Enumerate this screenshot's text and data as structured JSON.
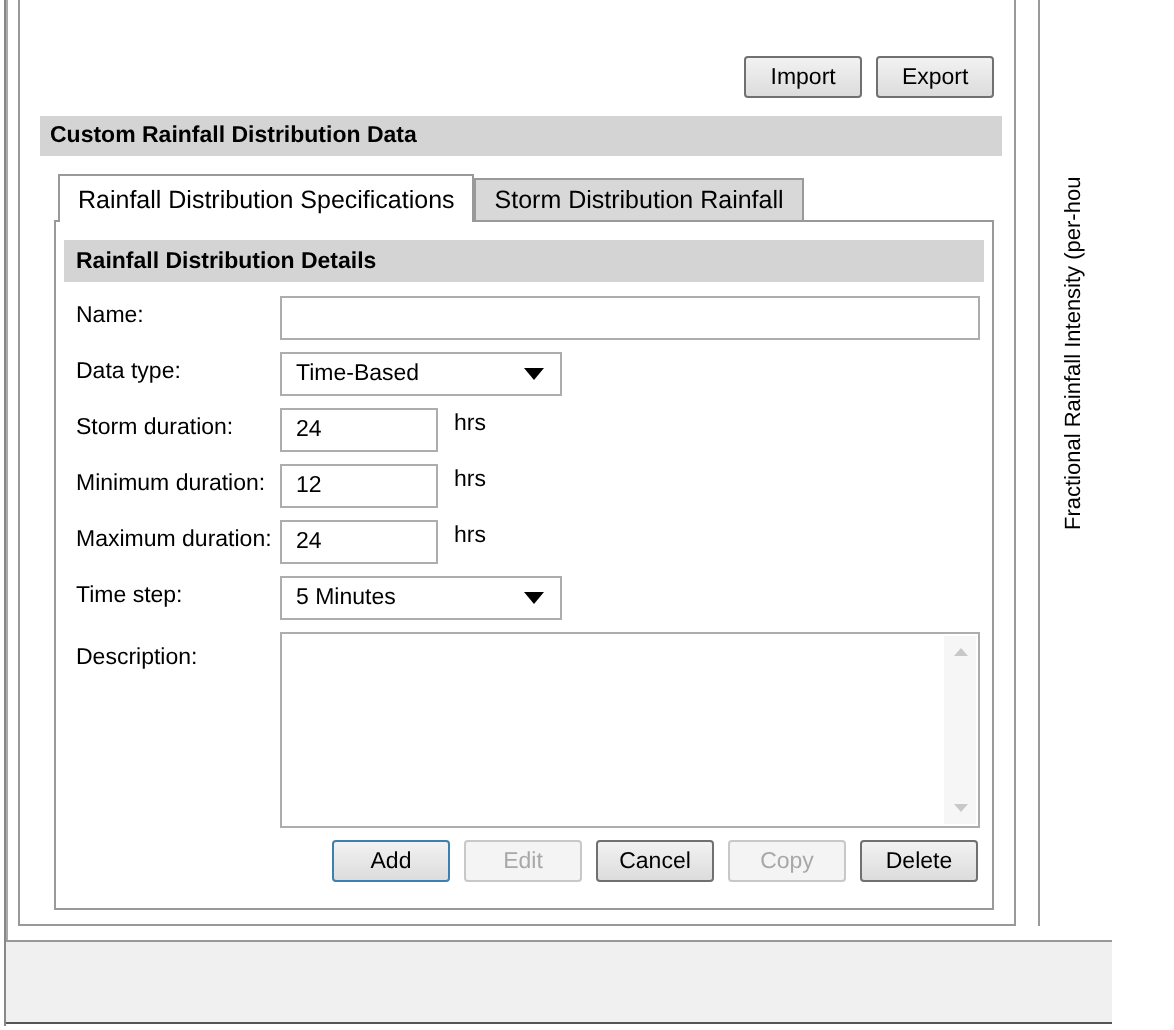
{
  "toolbar": {
    "buttons": [
      {
        "label": "Import",
        "disabled": false
      },
      {
        "label": "Export",
        "disabled": false
      }
    ]
  },
  "section": {
    "title": "Custom Rainfall Distribution Data"
  },
  "tabs": [
    {
      "label": "Rainfall Distribution Specifications",
      "selected": true
    },
    {
      "label": "Storm Distribution Rainfall",
      "selected": false
    }
  ],
  "details": {
    "title": "Rainfall Distribution Details",
    "fields": [
      {
        "kind": "text",
        "label": "Name:"
      },
      {
        "kind": "select",
        "label": "Data type:",
        "value": "Time-Based"
      },
      {
        "kind": "number",
        "label": "Storm duration:",
        "value": "24",
        "unit": "hrs"
      },
      {
        "kind": "number",
        "label": "Minimum duration:",
        "value": "12",
        "unit": "hrs"
      },
      {
        "kind": "number",
        "label": "Maximum duration:",
        "value": "24",
        "unit": "hrs"
      },
      {
        "kind": "select",
        "label": "Time step:",
        "value": "5 Minutes"
      },
      {
        "kind": "textarea",
        "label": "Description:"
      }
    ],
    "buttons": [
      {
        "label": "Add",
        "disabled": false,
        "default": true
      },
      {
        "label": "Edit",
        "disabled": true,
        "default": false
      },
      {
        "label": "Cancel",
        "disabled": false,
        "default": false
      },
      {
        "label": "Copy",
        "disabled": true,
        "default": false
      },
      {
        "label": "Delete",
        "disabled": false,
        "default": false
      }
    ]
  },
  "chart_panel": {
    "y_axis_label": "Fractional Rainfall Intensity (per-hou"
  }
}
